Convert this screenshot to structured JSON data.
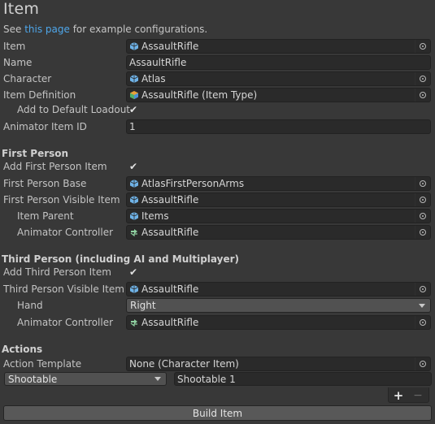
{
  "header": {
    "title": "Item",
    "desc_prefix": "See ",
    "desc_link": "this page",
    "desc_suffix": " for example configurations."
  },
  "general": {
    "item_label": "Item",
    "item_value": "AssaultRifle",
    "name_label": "Name",
    "name_value": "AssaultRifle",
    "character_label": "Character",
    "character_value": "Atlas",
    "item_definition_label": "Item Definition",
    "item_definition_value": "AssaultRifle (Item Type)",
    "add_default_loadout_label": "Add to Default Loadout",
    "add_default_loadout_checked": true,
    "animator_item_id_label": "Animator Item ID",
    "animator_item_id_value": "1"
  },
  "first_person": {
    "heading": "First Person",
    "add_label": "Add First Person Item",
    "add_checked": true,
    "base_label": "First Person Base",
    "base_value": "AtlasFirstPersonArms",
    "visible_item_label": "First Person Visible Item",
    "visible_item_value": "AssaultRifle",
    "item_parent_label": "Item Parent",
    "item_parent_value": "Items",
    "animator_controller_label": "Animator Controller",
    "animator_controller_value": "AssaultRifle"
  },
  "third_person": {
    "heading": "Third Person (including AI and Multiplayer)",
    "add_label": "Add Third Person Item",
    "add_checked": true,
    "visible_item_label": "Third Person Visible Item",
    "visible_item_value": "AssaultRifle",
    "hand_label": "Hand",
    "hand_value": "Right",
    "animator_controller_label": "Animator Controller",
    "animator_controller_value": "AssaultRifle"
  },
  "actions": {
    "heading": "Actions",
    "template_label": "Action Template",
    "template_value": "None (Character Item)",
    "action_type_value": "Shootable",
    "action_name_value": "Shootable 1",
    "add_symbol": "+",
    "remove_symbol": "−"
  },
  "footer": {
    "build_label": "Build Item"
  },
  "colors": {
    "background": "#383838",
    "field": "#2a2a2a",
    "link": "#4ea6ea",
    "prefab_icon": "#6fb3e8",
    "scriptable_icon": "#e8a23a"
  }
}
